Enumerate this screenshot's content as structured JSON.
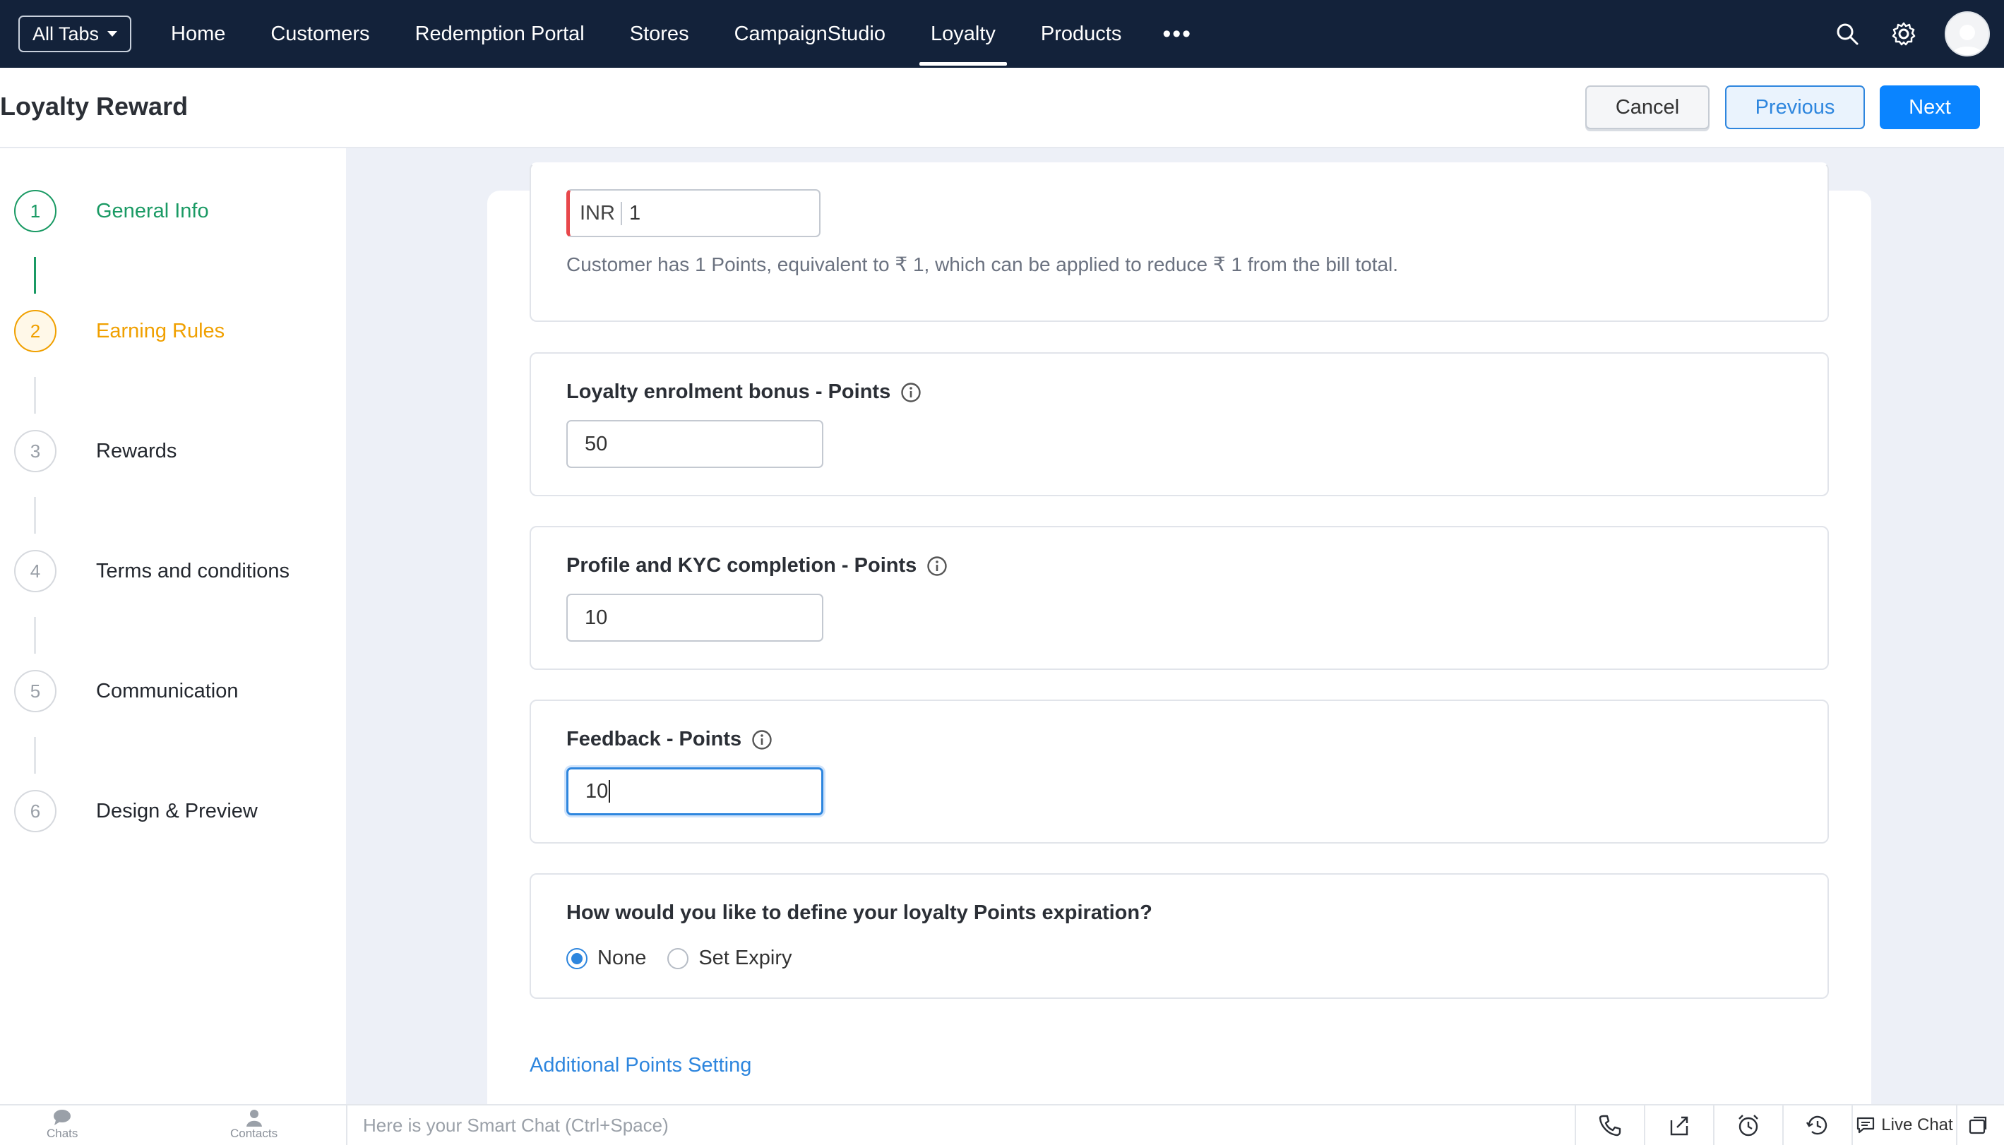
{
  "nav": {
    "all_tabs_label": "All Tabs",
    "tabs": [
      {
        "label": "Home"
      },
      {
        "label": "Customers"
      },
      {
        "label": "Redemption Portal"
      },
      {
        "label": "Stores"
      },
      {
        "label": "CampaignStudio"
      },
      {
        "label": "Loyalty",
        "active": true
      },
      {
        "label": "Products"
      }
    ],
    "more_label": "•••",
    "icons": [
      "search-icon",
      "gear-icon",
      "avatar"
    ]
  },
  "header": {
    "title": "Loyalty Reward",
    "cancel_label": "Cancel",
    "previous_label": "Previous",
    "next_label": "Next"
  },
  "steps": [
    {
      "number": "1",
      "label": "General Info",
      "state": "done"
    },
    {
      "number": "2",
      "label": "Earning Rules",
      "state": "current"
    },
    {
      "number": "3",
      "label": "Rewards",
      "state": "pending"
    },
    {
      "number": "4",
      "label": "Terms and conditions",
      "state": "pending"
    },
    {
      "number": "5",
      "label": "Communication",
      "state": "pending"
    },
    {
      "number": "6",
      "label": "Design & Preview",
      "state": "pending"
    }
  ],
  "form": {
    "conversion": {
      "currency": "INR",
      "value": "1",
      "helper": "Customer has 1 Points, equivalent to ₹ 1, which can be applied to reduce ₹ 1 from the bill total."
    },
    "enrolment": {
      "label": "Loyalty enrolment bonus - Points",
      "value": "50"
    },
    "kyc": {
      "label": "Profile and KYC completion - Points",
      "value": "10"
    },
    "feedback": {
      "label": "Feedback - Points",
      "value": "10"
    },
    "expiry": {
      "question": "How would you like to define your loyalty Points expiration?",
      "options": [
        {
          "label": "None",
          "checked": true
        },
        {
          "label": "Set Expiry",
          "checked": false
        }
      ]
    },
    "additional_link": "Additional Points Setting"
  },
  "bottom": {
    "chats_label": "Chats",
    "contacts_label": "Contacts",
    "smartchat_placeholder": "Here is your Smart Chat (Ctrl+Space)",
    "livechat_label": "Live Chat"
  },
  "colors": {
    "nav_bg": "#13223a",
    "primary": "#0a84ff",
    "done": "#1a9a64",
    "current": "#f0a000",
    "content_bg": "#edf0f7"
  }
}
